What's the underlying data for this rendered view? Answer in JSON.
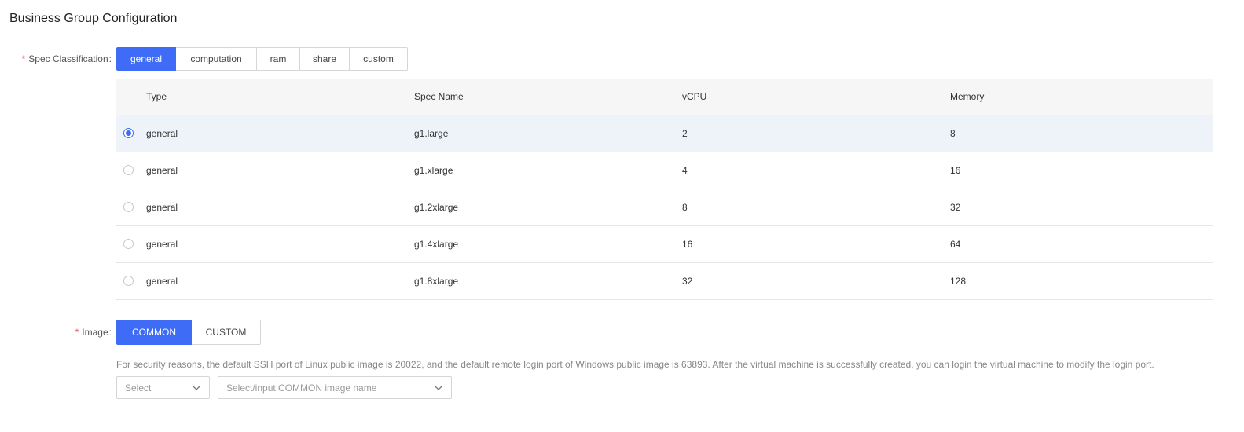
{
  "page": {
    "title": "Business Group Configuration"
  },
  "spec": {
    "label": "Spec Classification",
    "colon": ":",
    "required_mark": "*",
    "tabs": [
      {
        "label": "general",
        "active": true
      },
      {
        "label": "computation",
        "active": false
      },
      {
        "label": "ram",
        "active": false
      },
      {
        "label": "share",
        "active": false
      },
      {
        "label": "custom",
        "active": false
      }
    ]
  },
  "table": {
    "headers": [
      "Type",
      "Spec Name",
      "vCPU",
      "Memory"
    ],
    "rows": [
      {
        "selected": true,
        "type": "general",
        "spec": "g1.large",
        "vcpu": "2",
        "memory": "8"
      },
      {
        "selected": false,
        "type": "general",
        "spec": "g1.xlarge",
        "vcpu": "4",
        "memory": "16"
      },
      {
        "selected": false,
        "type": "general",
        "spec": "g1.2xlarge",
        "vcpu": "8",
        "memory": "32"
      },
      {
        "selected": false,
        "type": "general",
        "spec": "g1.4xlarge",
        "vcpu": "16",
        "memory": "64"
      },
      {
        "selected": false,
        "type": "general",
        "spec": "g1.8xlarge",
        "vcpu": "32",
        "memory": "128"
      }
    ]
  },
  "image": {
    "label": "Image",
    "colon": ":",
    "required_mark": "*",
    "tabs": [
      {
        "label": "COMMON",
        "active": true
      },
      {
        "label": "CUSTOM",
        "active": false
      }
    ],
    "hint": "For security reasons, the default SSH port of Linux public image is 20022, and the default remote login port of Windows public image is 63893. After the virtual machine is successfully created, you can login the virtual machine to modify the login port.",
    "os_select": {
      "placeholder": "Select",
      "icon": "chevron-down-icon"
    },
    "name_select": {
      "placeholder": "Select/input COMMON image name",
      "icon": "chevron-down-icon"
    }
  },
  "colors": {
    "accent": "#3e6cf6",
    "required": "#e34d59",
    "selected_row": "#edf3f8"
  }
}
